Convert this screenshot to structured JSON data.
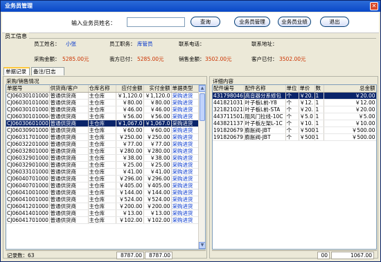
{
  "window": {
    "title": "业务员管理"
  },
  "search": {
    "label": "输入业务员姓名：",
    "value": "",
    "placeholder": ""
  },
  "buttons": {
    "query": "查询",
    "salesman_mgmt": "业务员管理",
    "salesman_perf": "业务员业绩",
    "exit": "退出"
  },
  "employee": {
    "section_title": "员工信息",
    "name_label": "员工姓名：",
    "name": "小张",
    "position_label": "员工职务：",
    "position": "库管员",
    "phone_label": "联系电话：",
    "phone": "",
    "address_label": "联系地址：",
    "address": "",
    "purchase_label": "采购金额：",
    "purchase": "5285.00元",
    "paid_label": "我方已付：",
    "paid": "5285.00元",
    "sales_label": "销售金额：",
    "sales": "3502.00元",
    "cust_paid_label": "客户已付：",
    "cust_paid": "3502.00元"
  },
  "tabs": [
    "单据记录",
    "备注/日志"
  ],
  "left": {
    "title": "采购/销售情况",
    "columns": [
      "单据号",
      "供货商/客户",
      "仓库名称",
      "应付金额",
      "实付金额",
      "单据类型"
    ],
    "rows": [
      [
        "CJ060301010001",
        "普通供货商",
        "主仓库",
        "￥1,120.0",
        "￥1,120.0",
        "采购进货"
      ],
      [
        "CJ060301010002",
        "普通供货商",
        "主仓库",
        "￥80.00",
        "￥80.00",
        "采购进货"
      ],
      [
        "CJ060301010003",
        "普通供货商",
        "主仓库",
        "￥46.00",
        "￥46.00",
        "采购进货"
      ],
      [
        "CJ060301010004",
        "普通供货商",
        "主仓库",
        "￥56.00",
        "￥56.00",
        "采购进货"
      ],
      [
        "CJ060306010001",
        "普通供货商",
        "主仓库",
        "￥1,067.0",
        "￥1,067.0",
        "采购进货"
      ],
      [
        "CJ060309010001",
        "普通供货商",
        "主仓库",
        "￥60.00",
        "￥60.00",
        "采购进货"
      ],
      [
        "CJ060317010001",
        "普通供货商",
        "主仓库",
        "￥250.00",
        "￥250.00",
        "采购进货"
      ],
      [
        "CJ060322010001",
        "普通供货商",
        "主仓库",
        "￥77.00",
        "￥77.00",
        "采购进货"
      ],
      [
        "CJ060328010001",
        "普通供货商",
        "主仓库",
        "￥280.00",
        "￥280.00",
        "采购进货"
      ],
      [
        "CJ060329010002",
        "普通供货商",
        "主仓库",
        "￥38.00",
        "￥38.00",
        "采购进货"
      ],
      [
        "CJ060329010003",
        "普通供货商",
        "主仓库",
        "￥25.00",
        "￥25.00",
        "采购进货"
      ],
      [
        "CJ060331010002",
        "普通供货商",
        "主仓库",
        "￥41.00",
        "￥41.00",
        "采购进货"
      ],
      [
        "CJ060407010001",
        "普通供货商",
        "主仓库",
        "￥296.00",
        "￥296.00",
        "采购进货"
      ],
      [
        "CJ060407010002",
        "普通供货商",
        "主仓库",
        "￥405.00",
        "￥405.00",
        "采购进货"
      ],
      [
        "CJ060410010001",
        "普通供货商",
        "主仓库",
        "￥144.00",
        "￥144.00",
        "采购进货"
      ],
      [
        "CJ060410010002",
        "普通供货商",
        "主仓库",
        "￥524.00",
        "￥524.00",
        "采购进货"
      ],
      [
        "CJ060412010001",
        "普通供货商",
        "主仓库",
        "￥200.00",
        "￥200.00",
        "采购进货"
      ],
      [
        "CJ060414010001",
        "普通供货商",
        "主仓库",
        "￥13.00",
        "￥13.00",
        "采购进货"
      ],
      [
        "CJ060417010001",
        "普通供货商",
        "主仓库",
        "￥102.00",
        "￥102.00",
        "采购进货"
      ]
    ],
    "selected_index": 4,
    "footer": {
      "count_label": "记录数：63",
      "total_payable": "8787.00",
      "total_paid": "8787.00"
    }
  },
  "right": {
    "title": "详细内容",
    "columns": [
      "配件编号",
      "配件名称",
      "单位",
      "单价",
      "数",
      "总金额"
    ],
    "rows": [
      [
        "431798046",
        "高音器分系修包",
        "个",
        "￥20.",
        "1",
        "￥20.00"
      ],
      [
        "441821031",
        "叶子板L前-Y8",
        "个",
        "￥12.",
        "1",
        "￥12.00"
      ],
      [
        "321821021N",
        "叶子板L前-STA",
        "个",
        "￥20.",
        "1",
        "￥20.00"
      ],
      [
        "443711501A",
        "阻风门拉线-10C",
        "个",
        "￥5.0",
        "1",
        "￥5.00"
      ],
      [
        "443821137",
        "叶子板左架L-1C",
        "个",
        "￥10.",
        "1",
        "￥10.00"
      ],
      [
        "191820679",
        "膨胀阀-JBT",
        "个",
        "￥500",
        "1",
        "￥500.00"
      ],
      [
        "191820679",
        "膨胀阀-JBT",
        "个",
        "￥500",
        "1",
        "￥500.00"
      ]
    ],
    "selected_index": 0,
    "footer": {
      "qty": "00",
      "total": "1067.00"
    }
  }
}
